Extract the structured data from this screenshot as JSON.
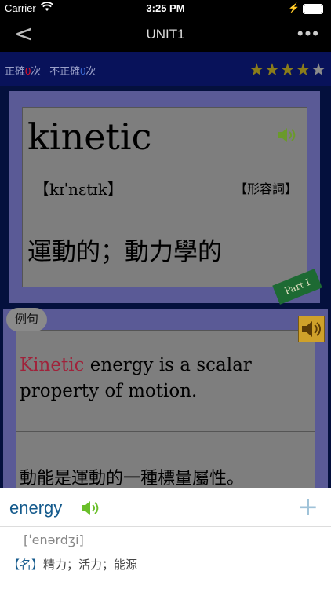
{
  "status": {
    "carrier": "Carrier",
    "time": "3:25 PM"
  },
  "nav": {
    "back": "<",
    "title": "UNIT1",
    "more": "•••"
  },
  "score": {
    "correct_prefix": "正確",
    "correct_count": "0",
    "correct_suffix": "次",
    "wrong_prefix": "不正確",
    "wrong_count": "0",
    "wrong_suffix": "次",
    "stars_filled": 4,
    "stars_total": 5
  },
  "card": {
    "word": "kinetic",
    "phonetic": "【kɪˈnɛtɪk】",
    "pos": "【形容詞】",
    "meaning": "運動的；動力學的",
    "part": "Part I"
  },
  "example": {
    "badge": "例句",
    "keyword": "Kinetic",
    "sentence_rest": " energy is a scalar property of motion.",
    "translation": "動能是運動的一種標量屬性。"
  },
  "popup": {
    "word": "energy",
    "phonetic": "[ˈenərdʒi]",
    "def_tag": "【名】",
    "definition": "精力；活力；能源",
    "plus": "+"
  },
  "colors": {
    "accent_blue": "#145a8c",
    "speaker_green": "#6a9a2a",
    "highlight_red": "#a0223a"
  }
}
